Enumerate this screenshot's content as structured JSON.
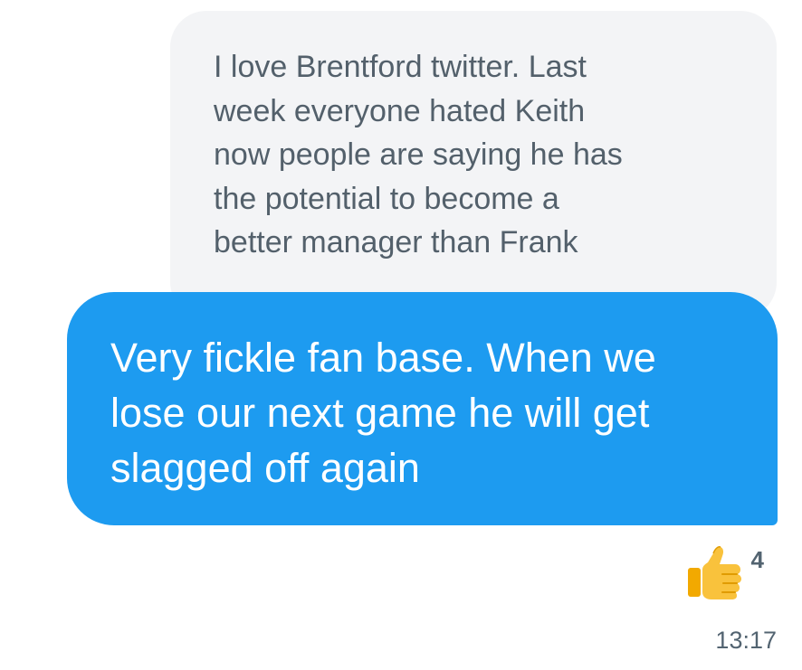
{
  "quoted_message": {
    "text": "I love Brentford twitter. Last\nweek everyone hated Keith\nnow people are saying he has\nthe potential to become a\nbetter manager than Frank"
  },
  "sent_message": {
    "text": "Very fickle fan base. When we\nlose our next game he will get\nslagged off again"
  },
  "reaction": {
    "icon": "thumbs-up-icon",
    "count": "4"
  },
  "timestamp": "13:17",
  "colors": {
    "sent_bubble": "#1d9bf0",
    "quoted_bubble": "#f3f4f6",
    "quoted_text": "#53606b",
    "meta_text": "#536471"
  }
}
